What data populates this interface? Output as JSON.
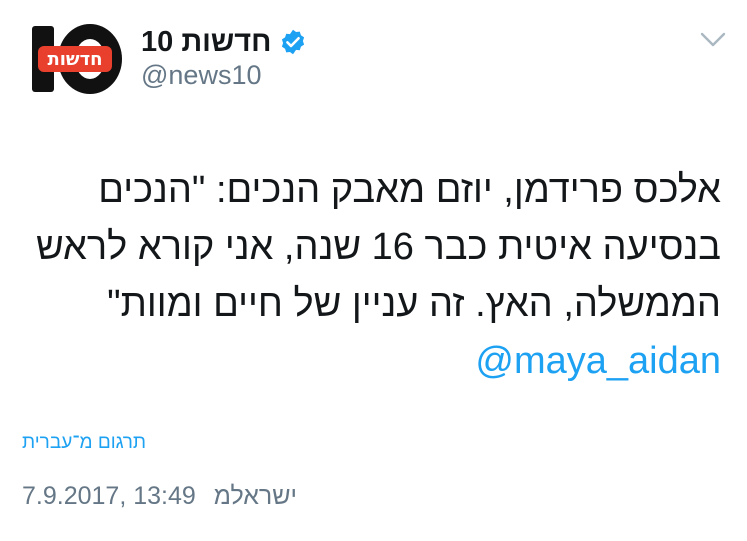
{
  "tweet": {
    "author": {
      "display_name": "חדשות 10",
      "handle": "@news10",
      "avatar_text": "חדשות",
      "avatar_number": "10",
      "verified": true
    },
    "text_lines": [
      "אלכס פרידמן, יוזם מאבק הנכים: \"הנכים",
      "בנסיעה איטית כבר 16 שנה, אני קורא לראש",
      "הממשלה, האץ. זה עניין של חיים ומוות\""
    ],
    "mention": "@maya_aidan",
    "translate_label": "תרגום מ־עברית",
    "timestamp": "7.9.2017, 13:49",
    "location": "ישראלמ"
  },
  "colors": {
    "link": "#1da1f2",
    "text": "#14171a",
    "secondary": "#657786",
    "avatar_bg": "#111111",
    "avatar_badge": "#e8402d"
  },
  "icons": {
    "verified": "verified-badge-icon",
    "menu": "chevron-down-icon"
  }
}
